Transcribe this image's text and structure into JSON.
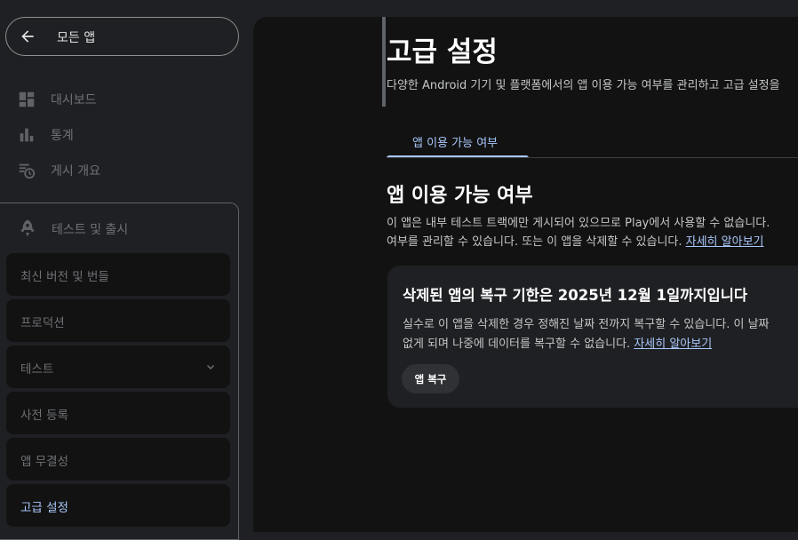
{
  "sidebar": {
    "back_label": "모든 앱",
    "nav": [
      {
        "label": "대시보드",
        "icon": "dashboard-icon"
      },
      {
        "label": "통계",
        "icon": "bar-chart-icon"
      },
      {
        "label": "게시 개요",
        "icon": "publishing-overview-icon"
      }
    ],
    "section": {
      "label": "테스트 및 출시",
      "icon": "rocket-icon",
      "items": [
        {
          "label": "최신 버전 및 번들"
        },
        {
          "label": "프로덕션"
        },
        {
          "label": "테스트",
          "expandable": true
        },
        {
          "label": "사전 등록"
        },
        {
          "label": "앱 무결성"
        },
        {
          "label": "고급 설정",
          "active": true
        }
      ]
    }
  },
  "main": {
    "title": "고급 설정",
    "description": "다양한 Android 기기 및 플랫폼에서의 앱 이용 가능 여부를 관리하고 고급 설정을",
    "tabs": [
      {
        "label": "앱 이용 가능 여부",
        "active": true
      }
    ],
    "section_title": "앱 이용 가능 여부",
    "section_desc_line1": "이 앱은 내부 테스트 트랙에만 게시되어 있으므로 Play에서 사용할 수 없습니다.",
    "section_desc_line2": "여부를 관리할 수 있습니다. 또는 이 앱을 삭제할 수 있습니다.",
    "learn_more": "자세히 알아보기",
    "card": {
      "title": "삭제된 앱의 복구 기한은 2025년 12월 1일까지입니다",
      "desc_line1": "실수로 이 앱을 삭제한 경우 정해진 날짜 전까지 복구할 수 있습니다. 이 날짜",
      "desc_line2": "없게 되며 나중에 데이터를 복구할 수 없습니다.",
      "learn_more": "자세히 알아보기",
      "button_label": "앱 복구"
    }
  },
  "colors": {
    "accent": "#a8c7fa",
    "background": "#1f2023",
    "content_background": "#121212"
  }
}
